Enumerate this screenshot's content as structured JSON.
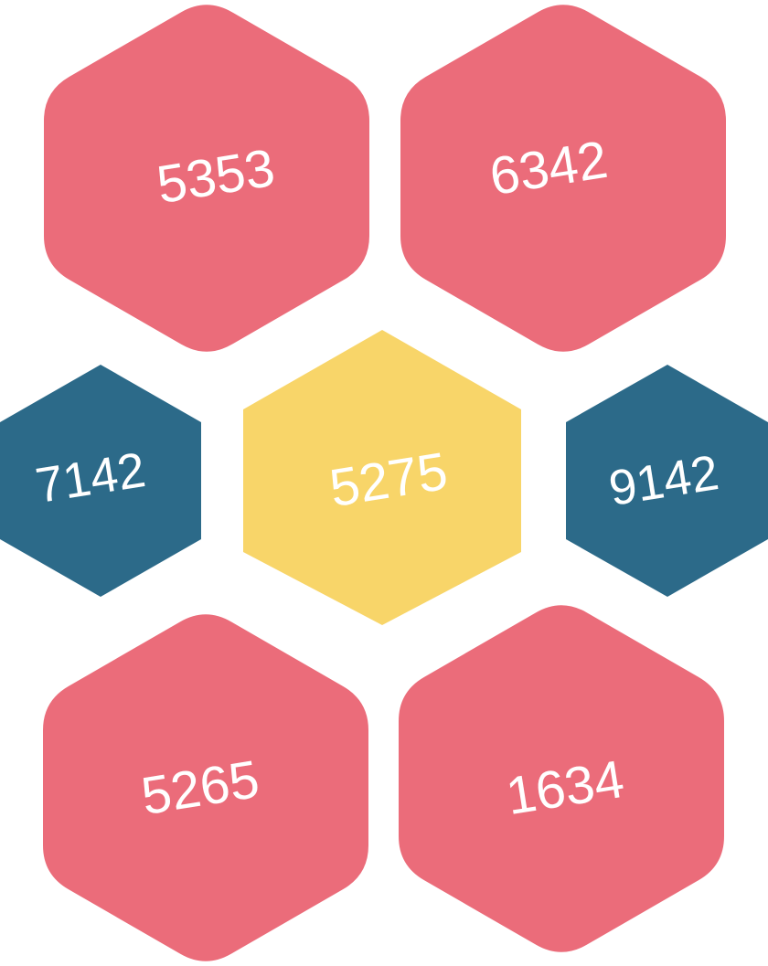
{
  "colors": {
    "background": "#ffffff",
    "pink": "#EB6C7A",
    "blue": "#2C6A89",
    "yellow": "#F8D569",
    "text": "#ffffff"
  },
  "tiles": [
    {
      "id": "top-left",
      "number": "5353",
      "color": "pink"
    },
    {
      "id": "top-right",
      "number": "6342",
      "color": "pink"
    },
    {
      "id": "middle-left",
      "number": "7142",
      "color": "blue"
    },
    {
      "id": "center",
      "number": "5275",
      "color": "yellow"
    },
    {
      "id": "middle-right",
      "number": "9142",
      "color": "blue"
    },
    {
      "id": "bottom-left",
      "number": "5265",
      "color": "pink"
    },
    {
      "id": "bottom-right",
      "number": "1634",
      "color": "pink"
    }
  ]
}
